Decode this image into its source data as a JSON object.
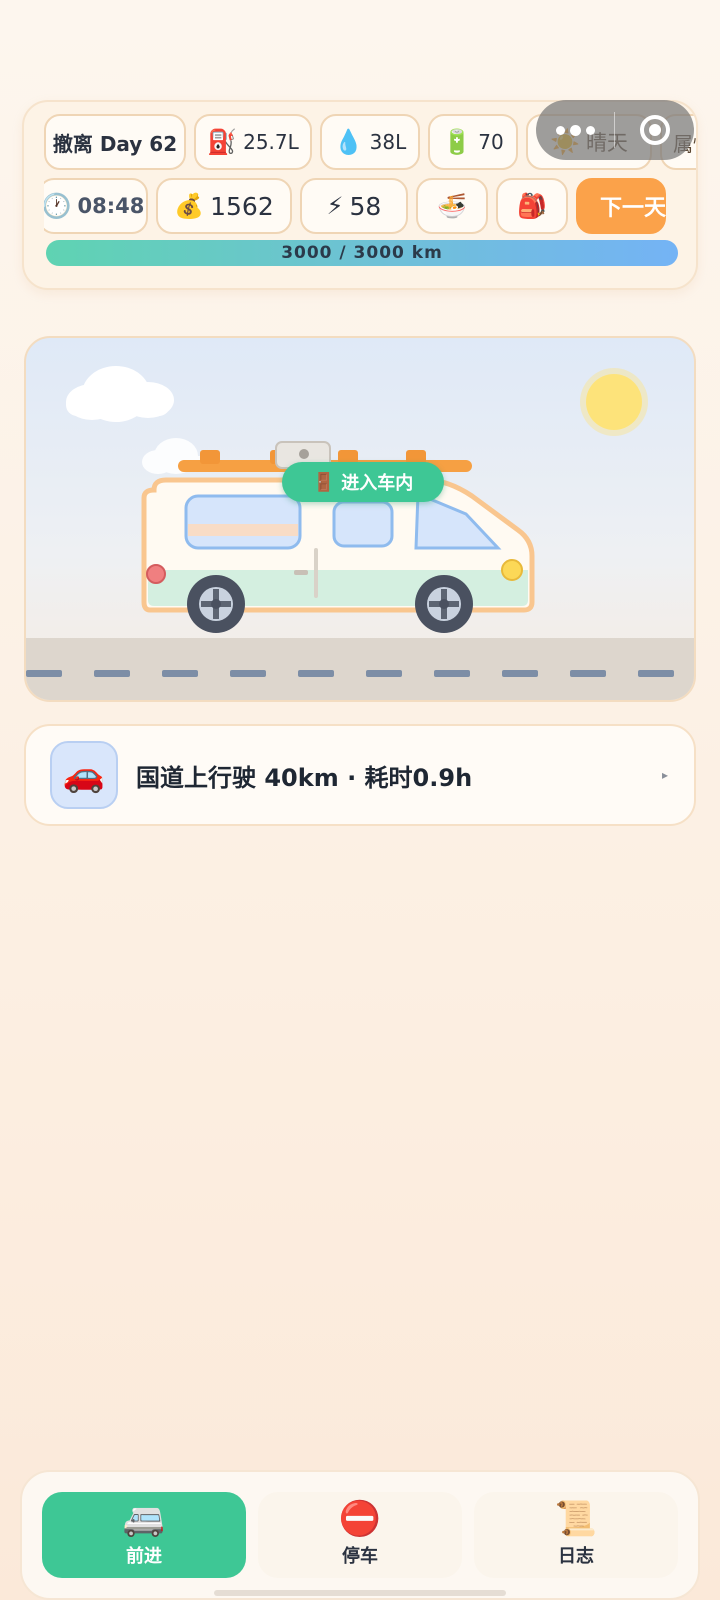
{
  "status": {
    "day": "撤离 Day 62",
    "fuel": {
      "icon": "⛽",
      "value": "25.7L"
    },
    "water": {
      "icon": "💧",
      "value": "38L"
    },
    "battery": {
      "icon": "🔋",
      "value": "70"
    },
    "weather": {
      "icon": "☀️",
      "value": "晴天"
    },
    "attributes_label": "属性",
    "time": {
      "icon": "🕐",
      "value": "08:48"
    },
    "money": {
      "icon": "💰",
      "value": "1562"
    },
    "energy": {
      "icon": "⚡",
      "value": "58"
    },
    "food_icon": "🍜",
    "bag_icon": "🎒",
    "next_day_label": "下一天",
    "progress": {
      "text": "3000 / 3000 km",
      "fraction": 1.0
    }
  },
  "scene": {
    "enter_label": "进入车内",
    "enter_icon": "🚪"
  },
  "event": {
    "icon": "🚗",
    "text": "国道上行驶 40km · 耗时0.9h",
    "arrow": "▸"
  },
  "nav": {
    "tabs": [
      {
        "label": "前进",
        "icon": "🚐",
        "active": true
      },
      {
        "label": "停车",
        "icon": "⛔",
        "active": false
      },
      {
        "label": "日志",
        "icon": "📜",
        "active": false
      }
    ]
  }
}
